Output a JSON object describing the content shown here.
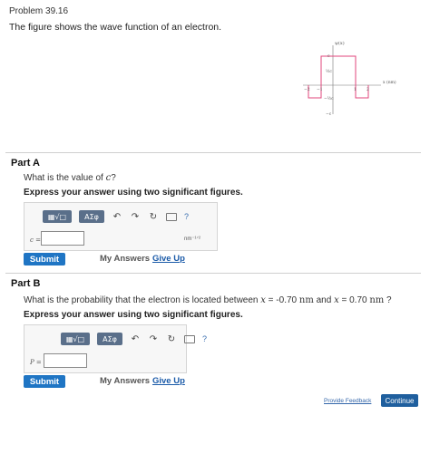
{
  "problem": {
    "title": "Problem 39.16",
    "description": "The figure shows the wave function of an electron."
  },
  "figure": {
    "y_label": "ψ(x)",
    "x_label": "x (nm)",
    "y_ticks": [
      "c",
      "½c",
      "−½c",
      "−c"
    ],
    "x_ticks": [
      "−2",
      "−1",
      "1",
      "2"
    ]
  },
  "toolbar": {
    "template_icon": "▦√□",
    "symbols_label": "ΑΣφ",
    "undo_icon": "undo-arrow",
    "redo_icon": "redo-arrow",
    "reset_icon": "reset-circle",
    "keyboard_icon": "keyboard",
    "help_label": "?"
  },
  "part_a": {
    "title": "Part A",
    "question_prefix": "What is the value of ",
    "question_var": "c",
    "question_suffix": "?",
    "instruction": "Express your answer using two significant figures.",
    "variable_label": "c =",
    "input_value": "",
    "unit": "nm⁻¹ᐟ²",
    "submit_label": "Submit",
    "my_answers_label": "My Answers",
    "give_up_label": "Give Up"
  },
  "part_b": {
    "title": "Part B",
    "question_prefix": "What is the probability that the electron is located between ",
    "q_x1": "x",
    "q_mid1": " = -0.70 ",
    "q_unit1": "nm",
    "q_and": " and ",
    "q_x2": "x",
    "q_mid2": " = 0.70 ",
    "q_unit2": "nm",
    "q_end": " ?",
    "instruction": "Express your answer using two significant figures.",
    "variable_label": "P =",
    "input_value": "",
    "submit_label": "Submit",
    "my_answers_label": "My Answers",
    "give_up_label": "Give Up"
  },
  "footer": {
    "feedback_label": "Provide Feedback",
    "continue_label": "Continue"
  },
  "colors": {
    "submit": "#1f75c4",
    "continue": "#1f5f9e",
    "wave": "#e0457b",
    "link": "#1a5aa8"
  }
}
